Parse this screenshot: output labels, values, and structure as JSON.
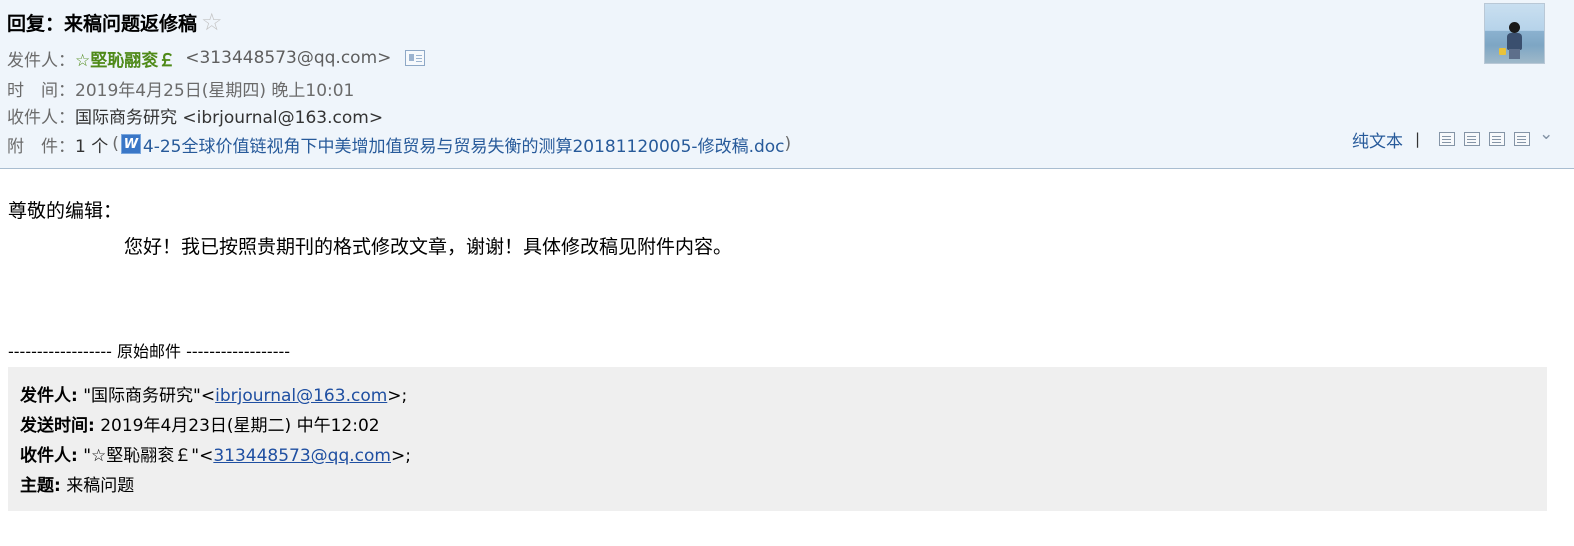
{
  "header": {
    "subject": "回复：来稿问题返修稿",
    "star_icon": "☆",
    "from": {
      "label": "发件人：",
      "name": "☆堅恥翮衮￡",
      "address": "<313448573@qq.com>"
    },
    "time": {
      "label": "时　间：",
      "value": "2019年4月25日(星期四) 晚上10:01"
    },
    "to": {
      "label": "收件人：",
      "value": "国际商务研究 <ibrjournal@163.com>"
    },
    "attachment": {
      "label": "附　件：",
      "count": "1 个",
      "open_paren": "(",
      "file_icon": "W",
      "filename": "4-25全球价值链视角下中美增加值贸易与贸易失衡的测算20181120005-修改稿.doc",
      "close_paren": ")"
    }
  },
  "toolbar": {
    "plain_text": "纯文本",
    "separator": "|",
    "icons": [
      "new-window-icon",
      "note-icon",
      "download-icon",
      "print-icon",
      "more-chevron-icon"
    ]
  },
  "body": {
    "greeting": "尊敬的编辑：",
    "content": "您好！我已按照贵期刊的格式修改文章，谢谢！具体修改稿见附件内容。"
  },
  "original": {
    "divider": "------------------ 原始邮件 ------------------",
    "from_label": "发件人:",
    "from_name": "\"国际商务研究\"<",
    "from_email": "ibrjournal@163.com",
    "from_suffix": ">;",
    "sent_label": "发送时间:",
    "sent_value": "2019年4月23日(星期二) 中午12:02",
    "to_label": "收件人:",
    "to_name": "\"☆堅恥翮衮￡\"<",
    "to_email": "313448573@qq.com",
    "to_suffix": ">;",
    "subject_label": "主题:",
    "subject_value": "来稿问题"
  },
  "colors": {
    "header_bg": "#eff5fb",
    "sender_name": "#4f8a19",
    "link": "#275a9a",
    "quote_bg": "#efefef"
  }
}
